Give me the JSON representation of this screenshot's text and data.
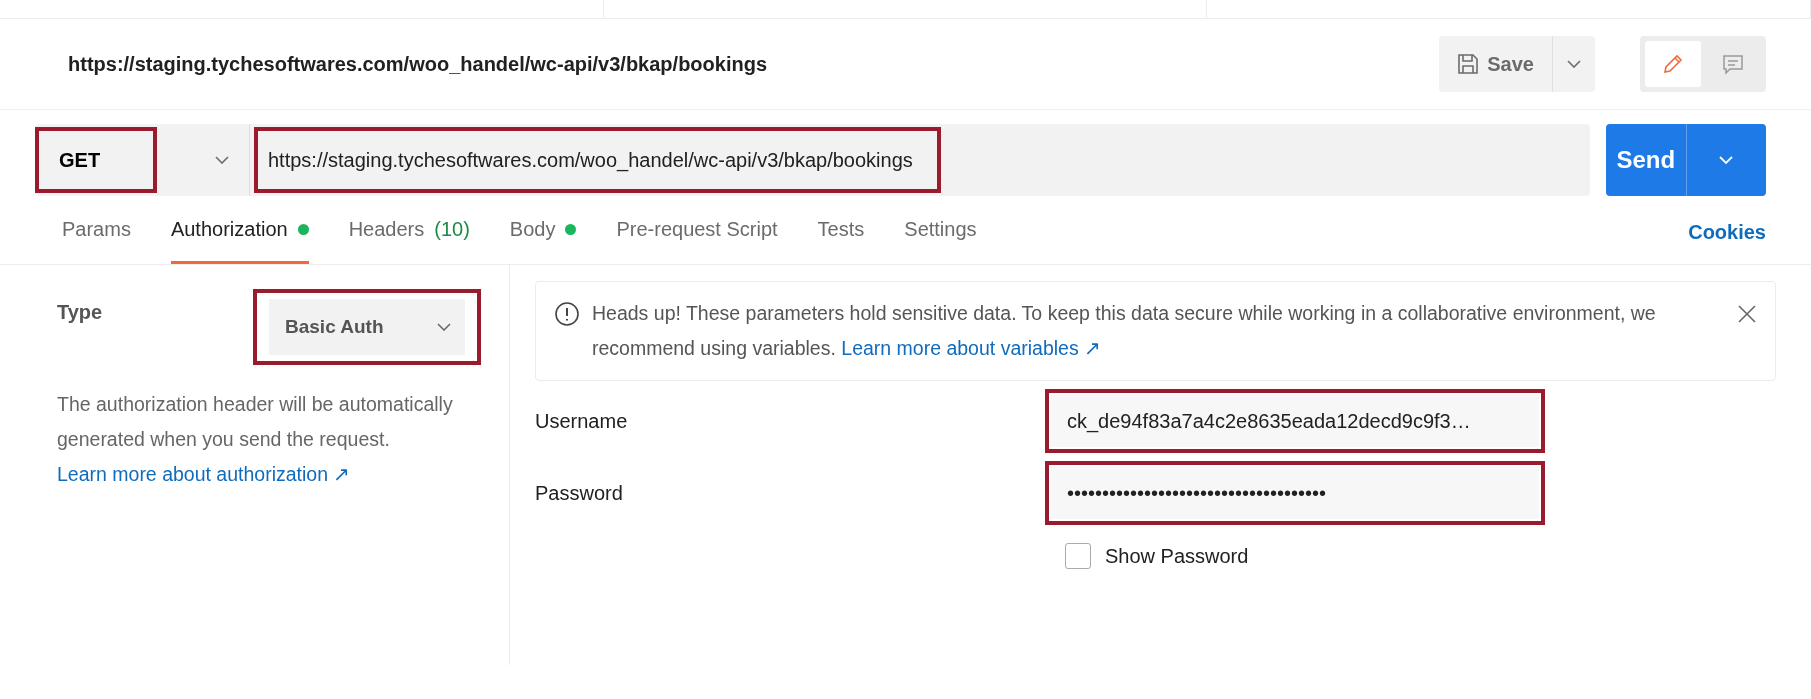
{
  "request_title": "https://staging.tychesoftwares.com/woo_handel/wc-api/v3/bkap/bookings",
  "save_button": {
    "label": "Save"
  },
  "mode_toggle": [
    {
      "kind": "edit",
      "selected": true
    },
    {
      "kind": "comment",
      "selected": false
    }
  ],
  "method": {
    "value": "GET",
    "highlighted": true
  },
  "url": {
    "value": "https://staging.tychesoftwares.com/woo_handel/wc-api/v3/bkap/bookings",
    "highlighted": true
  },
  "send_button": {
    "label": "Send"
  },
  "tabs": [
    {
      "label": "Params",
      "selected": false,
      "dot": false
    },
    {
      "label": "Authorization",
      "selected": true,
      "dot": true
    },
    {
      "label": "Headers",
      "count": "(10)",
      "selected": false,
      "dot": false
    },
    {
      "label": "Body",
      "selected": false,
      "dot": true
    },
    {
      "label": "Pre-request Script",
      "selected": false,
      "dot": false
    },
    {
      "label": "Tests",
      "selected": false,
      "dot": false
    },
    {
      "label": "Settings",
      "selected": false,
      "dot": false
    }
  ],
  "cookies_link": "Cookies",
  "auth": {
    "type_label": "Type",
    "type_value": "Basic Auth",
    "highlighted": true,
    "description": "The authorization header will be automatically generated when you send the request.",
    "learn_link": "Learn more about authorization ↗"
  },
  "notice": {
    "text": "Heads up! These parameters hold sensitive data. To keep this data secure while working in a collaborative environment, we recommend using variables.",
    "link": "Learn more about variables ↗"
  },
  "fields": [
    {
      "label": "Username",
      "value": "ck_de94f83a7a4c2e8635eada12decd9c9f3…",
      "highlighted": true
    },
    {
      "label": "Password",
      "value": "•••••••••••••••••••••••••••••••••••••",
      "highlighted": true
    }
  ],
  "show_password": {
    "label": "Show Password",
    "checked": false
  }
}
